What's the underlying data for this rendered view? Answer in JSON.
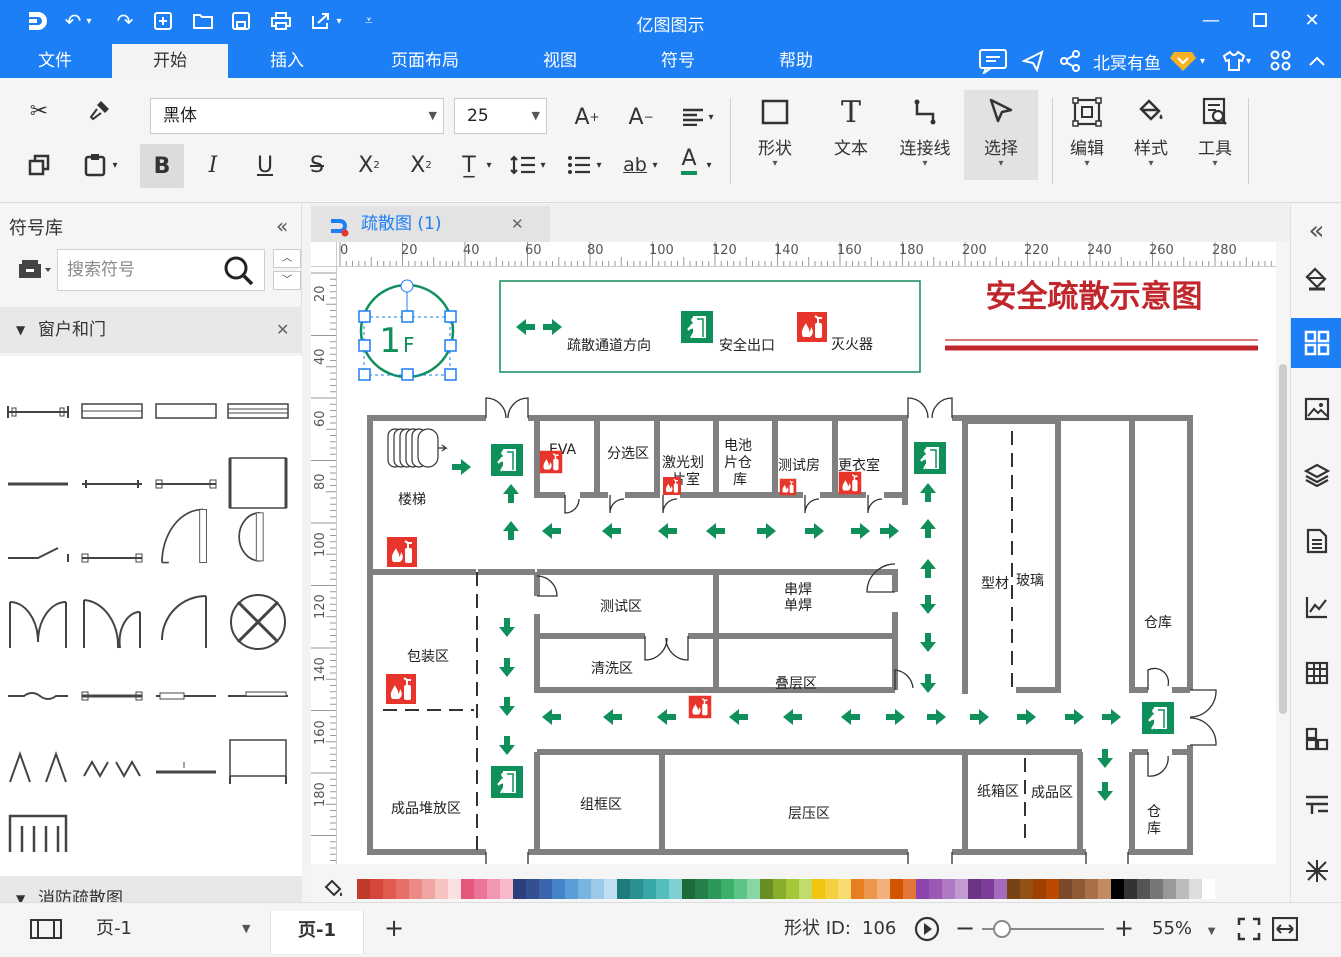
{
  "app": {
    "title": "亿图图示"
  },
  "colors": {
    "brand": "#1c7ff5",
    "green": "#0f8f5a",
    "red": "#e8352b",
    "title_red": "#c0262b",
    "wall": "#808080"
  },
  "quick_access": [
    "logo-icon",
    "undo-icon",
    "redo-icon",
    "new-icon",
    "open-icon",
    "save-icon",
    "print-icon",
    "export-icon",
    "customize-icon"
  ],
  "menu": {
    "items": [
      "文件",
      "开始",
      "插入",
      "页面布局",
      "视图",
      "符号",
      "帮助"
    ],
    "active": "开始",
    "user": "北冥有鱼"
  },
  "ribbon": {
    "font": "黑体",
    "size": "25",
    "big_buttons": [
      "形状",
      "文本",
      "连接线",
      "选择",
      "编辑",
      "样式",
      "工具"
    ]
  },
  "left_panel": {
    "title": "符号库",
    "search_placeholder": "搜索符号",
    "category1": "窗户和门",
    "category2": "消防疏散图"
  },
  "doc_tab": {
    "name": "疏散图 (1)"
  },
  "ruler": {
    "h": [
      "0",
      "20",
      "40",
      "60",
      "80",
      "100",
      "120",
      "140",
      "160",
      "180",
      "200",
      "220",
      "240",
      "260",
      "280"
    ],
    "v": [
      "20",
      "40",
      "60",
      "80",
      "100",
      "120",
      "140",
      "160",
      "180"
    ]
  },
  "plan": {
    "title": "安全疏散示意图",
    "floor": "1",
    "floor_suffix": "F",
    "legend": {
      "direction": "疏散通道方向",
      "exit": "安全出口",
      "extinguisher": "灭火器"
    },
    "rooms": {
      "stairs": "楼梯",
      "eva": "EVA",
      "sort": "分选区",
      "laser1": "激光划",
      "laser2": "片室",
      "battery1": "电池",
      "battery2": "片仓",
      "battery3": "库",
      "test_room": "测试房",
      "locker": "更衣室",
      "profile": "型材",
      "glass": "玻璃",
      "warehouse1": "仓库",
      "packing": "包装区",
      "test_area": "测试区",
      "weld1": "串焊",
      "weld2": "单焊",
      "wash": "清洗区",
      "layup": "叠层区",
      "finished": "成品堆放区",
      "frame": "组框区",
      "laminate": "层压区",
      "carton": "纸箱区",
      "product": "成品区",
      "wh2a": "仓",
      "wh2b": "库"
    }
  },
  "status": {
    "page_selector": "页-1",
    "page_tab": "页-1",
    "shape_id_label": "形状 ID:",
    "shape_id": "106",
    "zoom": "55%"
  }
}
